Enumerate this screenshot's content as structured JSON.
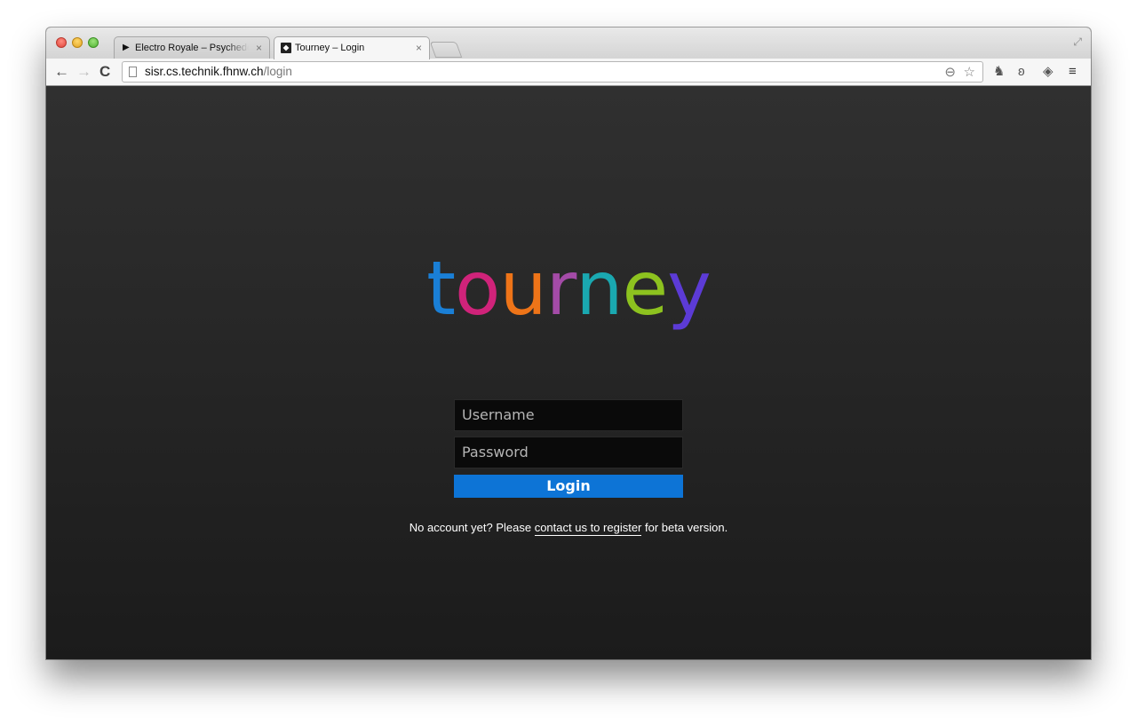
{
  "browser": {
    "tabs": [
      {
        "icon": "play-icon",
        "title": "Electro Royale – Psychedelic",
        "close": "×",
        "active": false
      },
      {
        "icon": "tourney-favicon",
        "title": "Tourney – Login",
        "close": "×",
        "active": true
      }
    ],
    "nav": {
      "back": "←",
      "forward": "→",
      "reload": "C"
    },
    "url": {
      "host": "sisr.cs.technik.fhnw.ch",
      "path": "/login"
    },
    "omnibox_icons": {
      "zoom": "⊖",
      "star": "☆"
    },
    "extensions": [
      "evernote-icon",
      "pocket-icon",
      "dropbox-icon"
    ],
    "extension_glyphs": [
      "♞",
      "ʚ",
      "◈"
    ],
    "menu": "≡",
    "fullscreen": "⤢"
  },
  "page": {
    "logo_letters": [
      {
        "char": "t",
        "color": "#1a7fd6"
      },
      {
        "char": "o",
        "color": "#d0237a"
      },
      {
        "char": "u",
        "color": "#ee7418"
      },
      {
        "char": "r",
        "color": "#a44ba7"
      },
      {
        "char": "n",
        "color": "#1aa8b0"
      },
      {
        "char": "e",
        "color": "#8dc21f"
      },
      {
        "char": "y",
        "color": "#5c3bd6"
      }
    ],
    "username_placeholder": "Username",
    "password_placeholder": "Password",
    "login_label": "Login",
    "note_before": "No account yet? Please ",
    "note_link": "contact us to register",
    "note_after": " for beta version."
  }
}
